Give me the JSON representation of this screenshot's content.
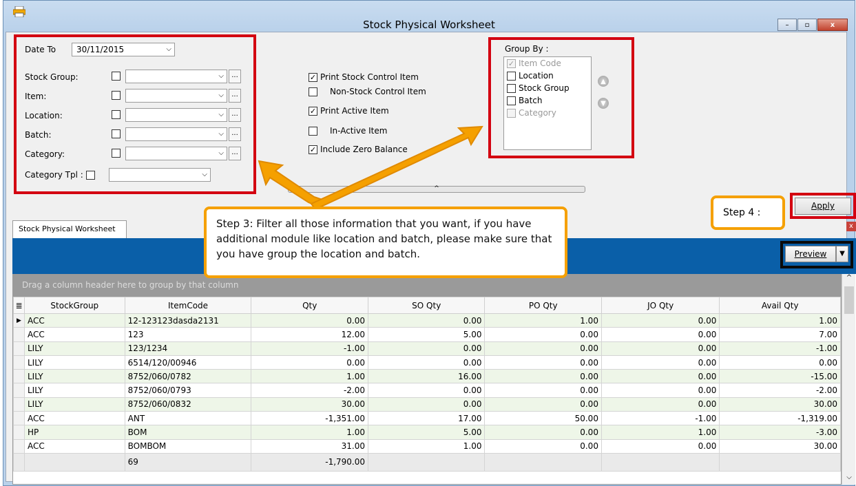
{
  "window": {
    "title": "Stock Physical Worksheet",
    "minimize": "–",
    "maximize": "▫",
    "close": "x"
  },
  "filters": {
    "date_label": "Date To",
    "date_value": "30/11/2015",
    "stock_group_label": "Stock Group:",
    "item_label": "Item:",
    "location_label": "Location:",
    "batch_label": "Batch:",
    "category_label": "Category:",
    "category_tpl_label": "Category Tpl :",
    "ellipsis": "..."
  },
  "options": {
    "print_stock_control": "Print Stock Control Item",
    "non_stock_control": "Non-Stock Control Item",
    "print_active": "Print Active Item",
    "inactive": "In-Active Item",
    "include_zero": "Include Zero Balance"
  },
  "group_by": {
    "label": "Group By :",
    "items": [
      "Item Code",
      "Location",
      "Stock Group",
      "Batch",
      "Category"
    ]
  },
  "actions": {
    "apply": "Apply",
    "preview": "Preview"
  },
  "tab": {
    "label": "Stock Physical Worksheet",
    "close": "x"
  },
  "grid": {
    "group_hint": "Drag a column header here to group by that column",
    "columns": [
      "StockGroup",
      "ItemCode",
      "Qty",
      "SO Qty",
      "PO Qty",
      "JO Qty",
      "Avail Qty"
    ],
    "rows": [
      [
        "ACC",
        "12-123123dasda2131",
        "0.00",
        "0.00",
        "1.00",
        "0.00",
        "1.00"
      ],
      [
        "ACC",
        "123",
        "12.00",
        "5.00",
        "0.00",
        "0.00",
        "7.00"
      ],
      [
        "LILY",
        "123/1234",
        "-1.00",
        "0.00",
        "0.00",
        "0.00",
        "-1.00"
      ],
      [
        "LILY",
        "6514/120/00946",
        "0.00",
        "0.00",
        "0.00",
        "0.00",
        "0.00"
      ],
      [
        "LILY",
        "8752/060/0782",
        "1.00",
        "16.00",
        "0.00",
        "0.00",
        "-15.00"
      ],
      [
        "LILY",
        "8752/060/0793",
        "-2.00",
        "0.00",
        "0.00",
        "0.00",
        "-2.00"
      ],
      [
        "LILY",
        "8752/060/0832",
        "30.00",
        "0.00",
        "0.00",
        "0.00",
        "30.00"
      ],
      [
        "ACC",
        "ANT",
        "-1,351.00",
        "17.00",
        "50.00",
        "-1.00",
        "-1,319.00"
      ],
      [
        "HP",
        "BOM",
        "1.00",
        "5.00",
        "0.00",
        "1.00",
        "-3.00"
      ],
      [
        "ACC",
        "BOMBOM",
        "31.00",
        "1.00",
        "0.00",
        "0.00",
        "30.00"
      ]
    ],
    "footer": {
      "count": "69",
      "qty_total": "-1,790.00"
    }
  },
  "callouts": {
    "step3": "Step 3: Filter all those information that you want, if you have additional module like location and batch, please make sure that you have group the location and batch.",
    "step4": "Step 4 :"
  },
  "colors": {
    "highlight_red": "#d30010",
    "callout_orange": "#f5a000",
    "header_blue": "#0a5fa8",
    "row_green": "#eef6e8"
  }
}
